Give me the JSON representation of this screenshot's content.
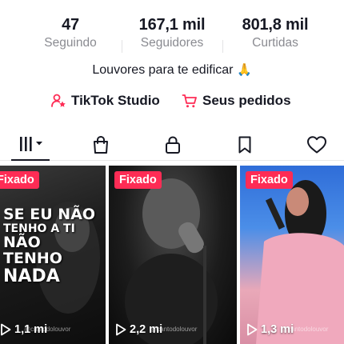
{
  "stats": [
    {
      "value": "47",
      "label": "Seguindo"
    },
    {
      "value": "167,1 mil",
      "label": "Seguidores"
    },
    {
      "value": "801,8 mil",
      "label": "Curtidas"
    }
  ],
  "bio": {
    "text": "Louvores para te edificar",
    "emoji": "🙏"
  },
  "links": {
    "studio": "TikTok Studio",
    "orders": "Seus pedidos"
  },
  "accent_color": "#fe2c55",
  "tabs": [
    "videos-grid-icon",
    "shop-bag-icon",
    "lock-icon",
    "bookmark-icon",
    "heart-icon"
  ],
  "videos": [
    {
      "pinned_label": "Fixado",
      "views": "1,1 mi",
      "overlay": [
        "SE EU NÃO",
        "TENHO A TI",
        "NÃO",
        "TENHO",
        "NADA"
      ],
      "watermark": "@cantodolouvor"
    },
    {
      "pinned_label": "Fixado",
      "views": "2,2 mi",
      "watermark": "@cantodolouvor"
    },
    {
      "pinned_label": "Fixado",
      "views": "1,3 mi",
      "watermark": "@cantodolouvor"
    }
  ]
}
